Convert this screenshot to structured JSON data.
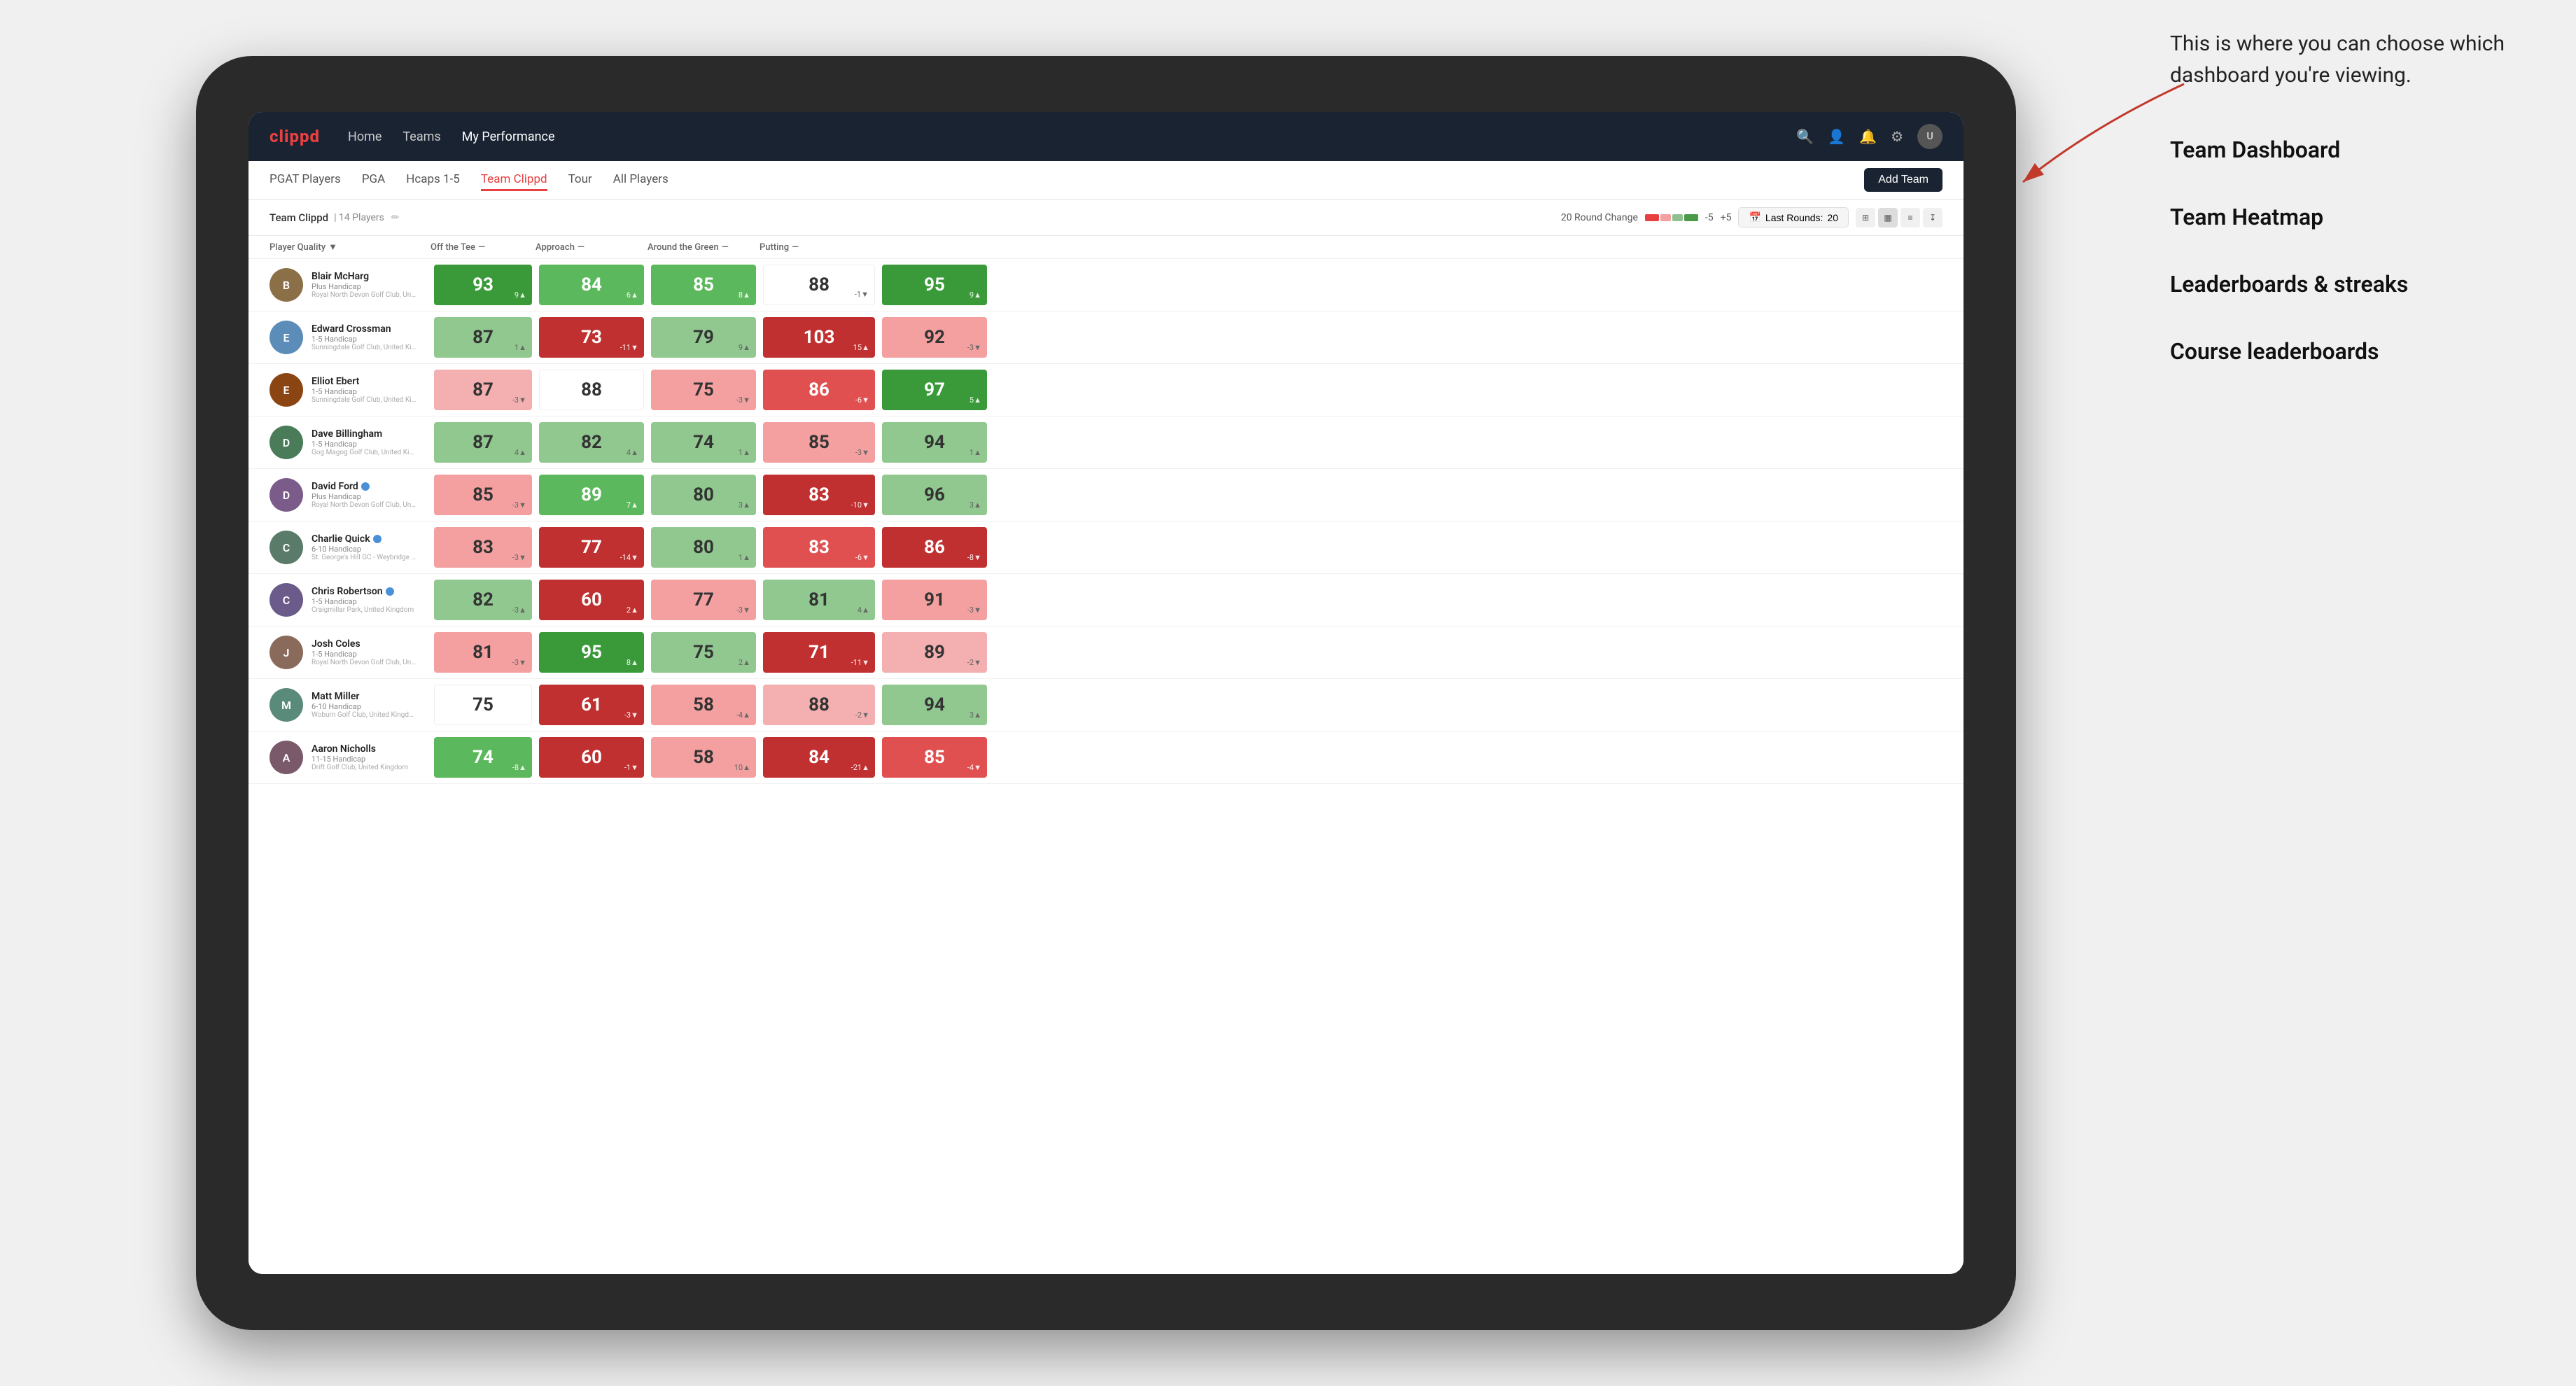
{
  "annotation": {
    "intro_text": "This is where you can choose which dashboard you're viewing.",
    "items": [
      "Team Dashboard",
      "Team Heatmap",
      "Leaderboards & streaks",
      "Course leaderboards"
    ]
  },
  "nav": {
    "logo": "clippd",
    "links": [
      "Home",
      "Teams",
      "My Performance"
    ],
    "active_link": "My Performance",
    "icons": [
      "search",
      "user",
      "bell",
      "settings",
      "avatar"
    ]
  },
  "sub_nav": {
    "links": [
      "PGAT Players",
      "PGA",
      "Hcaps 1-5",
      "Team Clippd",
      "Tour",
      "All Players"
    ],
    "active_link": "Team Clippd",
    "add_button": "Add Team"
  },
  "team_header": {
    "name": "Team Clippd",
    "separator": "|",
    "count": "14 Players",
    "round_change_label": "20 Round Change",
    "range_min": "-5",
    "range_max": "+5",
    "last_rounds_label": "Last Rounds:",
    "last_rounds_value": "20"
  },
  "columns": [
    {
      "label": "Player Quality",
      "arrow": "▼"
    },
    {
      "label": "Off the Tee",
      "arrow": "—"
    },
    {
      "label": "Approach",
      "arrow": "—"
    },
    {
      "label": "Around the Green",
      "arrow": "—"
    },
    {
      "label": "Putting",
      "arrow": "—"
    }
  ],
  "players": [
    {
      "name": "Blair McHarg",
      "handicap": "Plus Handicap",
      "club": "Royal North Devon Golf Club, United Kingdom",
      "scores": [
        {
          "value": "93",
          "change": "9▲",
          "bg": "green-dark"
        },
        {
          "value": "84",
          "change": "6▲",
          "bg": "green-med"
        },
        {
          "value": "85",
          "change": "8▲",
          "bg": "green-med"
        },
        {
          "value": "88",
          "change": "-1▼",
          "bg": "white"
        },
        {
          "value": "95",
          "change": "9▲",
          "bg": "green-dark"
        }
      ]
    },
    {
      "name": "Edward Crossman",
      "handicap": "1-5 Handicap",
      "club": "Sunningdale Golf Club, United Kingdom",
      "scores": [
        {
          "value": "87",
          "change": "1▲",
          "bg": "green-light"
        },
        {
          "value": "73",
          "change": "-11▼",
          "bg": "red-dark"
        },
        {
          "value": "79",
          "change": "9▲",
          "bg": "green-light"
        },
        {
          "value": "103",
          "change": "15▲",
          "bg": "red-dark"
        },
        {
          "value": "92",
          "change": "-3▼",
          "bg": "red-light"
        }
      ]
    },
    {
      "name": "Elliot Ebert",
      "handicap": "1-5 Handicap",
      "club": "Sunningdale Golf Club, United Kingdom",
      "scores": [
        {
          "value": "87",
          "change": "-3▼",
          "bg": "salmon"
        },
        {
          "value": "88",
          "change": "",
          "bg": "white"
        },
        {
          "value": "75",
          "change": "-3▼",
          "bg": "red-light"
        },
        {
          "value": "86",
          "change": "-6▼",
          "bg": "red-med"
        },
        {
          "value": "97",
          "change": "5▲",
          "bg": "green-dark"
        }
      ]
    },
    {
      "name": "Dave Billingham",
      "handicap": "1-5 Handicap",
      "club": "Gog Magog Golf Club, United Kingdom",
      "scores": [
        {
          "value": "87",
          "change": "4▲",
          "bg": "green-light"
        },
        {
          "value": "82",
          "change": "4▲",
          "bg": "green-light"
        },
        {
          "value": "74",
          "change": "1▲",
          "bg": "green-light"
        },
        {
          "value": "85",
          "change": "-3▼",
          "bg": "red-light"
        },
        {
          "value": "94",
          "change": "1▲",
          "bg": "green-light"
        }
      ]
    },
    {
      "name": "David Ford",
      "handicap": "Plus Handicap",
      "club": "Royal North Devon Golf Club, United Kingdom",
      "verified": true,
      "scores": [
        {
          "value": "85",
          "change": "-3▼",
          "bg": "red-light"
        },
        {
          "value": "89",
          "change": "7▲",
          "bg": "green-med"
        },
        {
          "value": "80",
          "change": "3▲",
          "bg": "green-light"
        },
        {
          "value": "83",
          "change": "-10▼",
          "bg": "red-dark"
        },
        {
          "value": "96",
          "change": "3▲",
          "bg": "green-light"
        }
      ]
    },
    {
      "name": "Charlie Quick",
      "handicap": "6-10 Handicap",
      "club": "St. George's Hill GC - Weybridge - Surrey, Uni...",
      "verified": true,
      "scores": [
        {
          "value": "83",
          "change": "-3▼",
          "bg": "red-light"
        },
        {
          "value": "77",
          "change": "-14▼",
          "bg": "red-dark"
        },
        {
          "value": "80",
          "change": "1▲",
          "bg": "green-light"
        },
        {
          "value": "83",
          "change": "-6▼",
          "bg": "red-med"
        },
        {
          "value": "86",
          "change": "-8▼",
          "bg": "red-dark"
        }
      ]
    },
    {
      "name": "Chris Robertson",
      "handicap": "1-5 Handicap",
      "club": "Craigmillar Park, United Kingdom",
      "verified": true,
      "scores": [
        {
          "value": "82",
          "change": "-3▲",
          "bg": "green-light"
        },
        {
          "value": "60",
          "change": "2▲",
          "bg": "red-dark"
        },
        {
          "value": "77",
          "change": "-3▼",
          "bg": "red-light"
        },
        {
          "value": "81",
          "change": "4▲",
          "bg": "green-light"
        },
        {
          "value": "91",
          "change": "-3▼",
          "bg": "red-light"
        }
      ]
    },
    {
      "name": "Josh Coles",
      "handicap": "1-5 Handicap",
      "club": "Royal North Devon Golf Club, United Kingdom",
      "scores": [
        {
          "value": "81",
          "change": "-3▼",
          "bg": "red-light"
        },
        {
          "value": "95",
          "change": "8▲",
          "bg": "green-dark"
        },
        {
          "value": "75",
          "change": "2▲",
          "bg": "green-light"
        },
        {
          "value": "71",
          "change": "-11▼",
          "bg": "red-dark"
        },
        {
          "value": "89",
          "change": "-2▼",
          "bg": "salmon"
        }
      ]
    },
    {
      "name": "Matt Miller",
      "handicap": "6-10 Handicap",
      "club": "Woburn Golf Club, United Kingdom",
      "scores": [
        {
          "value": "75",
          "change": "",
          "bg": "white"
        },
        {
          "value": "61",
          "change": "-3▼",
          "bg": "red-dark"
        },
        {
          "value": "58",
          "change": "-4▲",
          "bg": "red-light"
        },
        {
          "value": "88",
          "change": "-2▼",
          "bg": "salmon"
        },
        {
          "value": "94",
          "change": "3▲",
          "bg": "green-light"
        }
      ]
    },
    {
      "name": "Aaron Nicholls",
      "handicap": "11-15 Handicap",
      "club": "Drift Golf Club, United Kingdom",
      "scores": [
        {
          "value": "74",
          "change": "-8▲",
          "bg": "green-med"
        },
        {
          "value": "60",
          "change": "-1▼",
          "bg": "red-dark"
        },
        {
          "value": "58",
          "change": "10▲",
          "bg": "red-light"
        },
        {
          "value": "84",
          "change": "-21▲",
          "bg": "red-dark"
        },
        {
          "value": "85",
          "change": "-4▼",
          "bg": "red-med"
        }
      ]
    }
  ]
}
